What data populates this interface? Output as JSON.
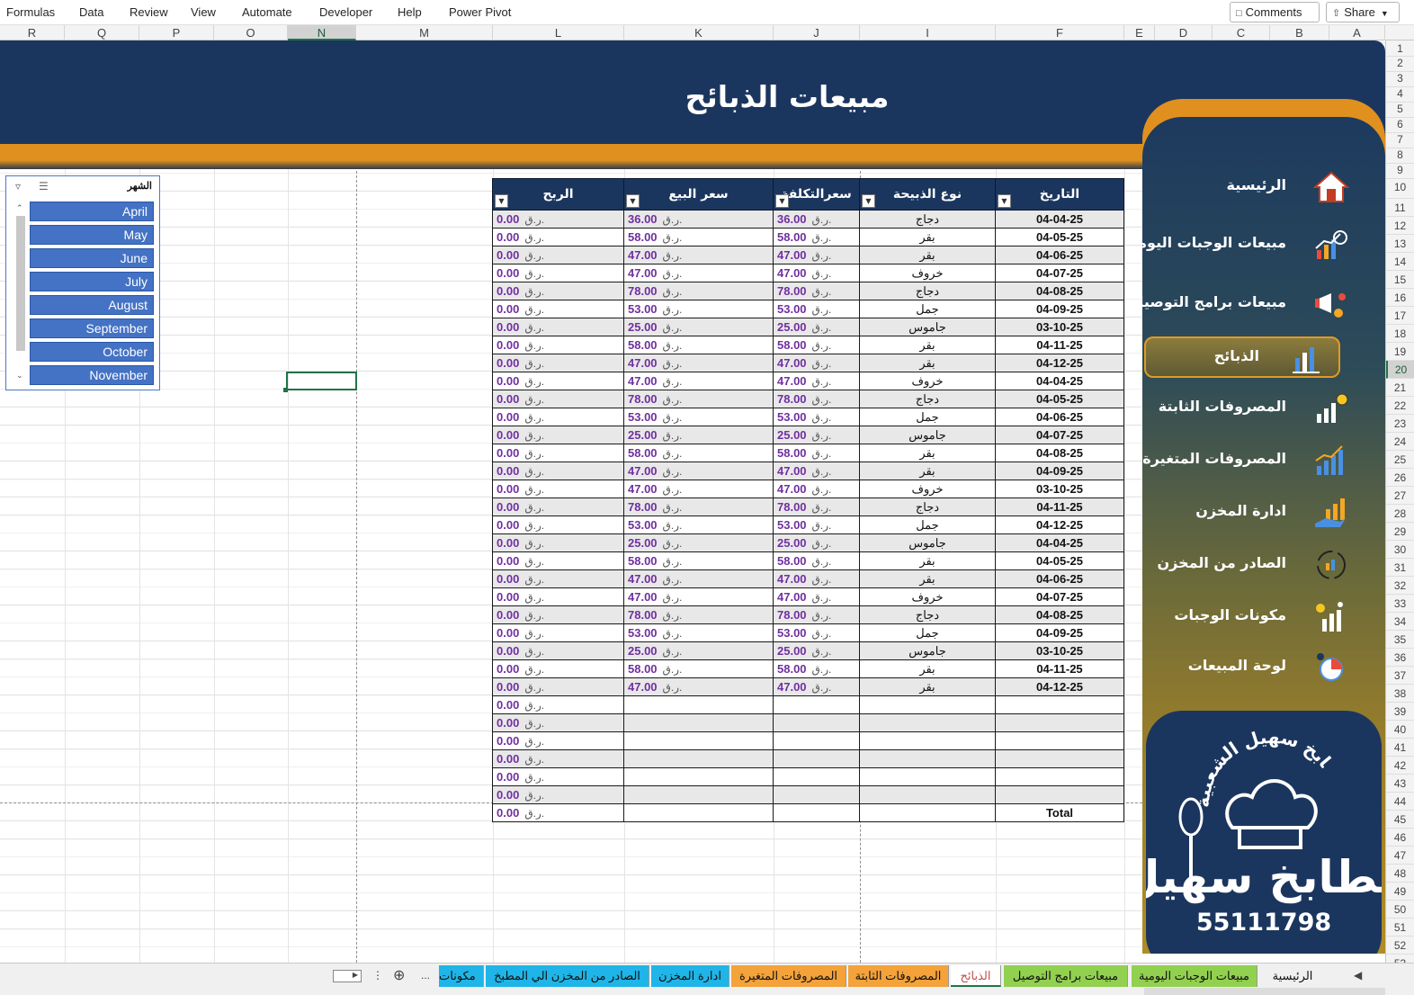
{
  "menu": {
    "items": [
      "Formulas",
      "Data",
      "Review",
      "View",
      "Automate",
      "Developer",
      "Help",
      "Power Pivot"
    ],
    "comments_label": "Comments",
    "share_label": "Share"
  },
  "columns": {
    "letters": [
      "R",
      "Q",
      "P",
      "O",
      "N",
      "M",
      "L",
      "K",
      "J",
      "I",
      "F",
      "E",
      "D",
      "C",
      "B",
      "A"
    ],
    "selected": "N"
  },
  "rows": {
    "numbers": [
      "1",
      "2",
      "3",
      "4",
      "5",
      "6",
      "7",
      "8",
      "9",
      "10",
      "11",
      "12",
      "13",
      "14",
      "15",
      "16",
      "17",
      "18",
      "19",
      "20",
      "21",
      "22",
      "23",
      "24",
      "25",
      "26",
      "27",
      "28",
      "29",
      "30",
      "31",
      "32",
      "33",
      "34",
      "35",
      "36",
      "37",
      "38",
      "39",
      "40",
      "41",
      "42",
      "43",
      "44",
      "45",
      "46",
      "47",
      "48",
      "49",
      "50",
      "51",
      "52",
      "53"
    ],
    "selected": "20"
  },
  "banner": {
    "title": "مبيعات الذبائح"
  },
  "sidebar": {
    "items": [
      {
        "label": "الرئيسية",
        "icon": "home-icon"
      },
      {
        "label": "مبيعات الوجبات اليومية",
        "icon": "growth-chart-icon"
      },
      {
        "label": "مبيعات برامج التوصيل",
        "icon": "megaphone-icon"
      },
      {
        "label": "الذبائح",
        "icon": "bar-chart-icon",
        "active": true
      },
      {
        "label": "المصروفات الثابتة",
        "icon": "coins-chart-icon"
      },
      {
        "label": "المصروفات المتغيرة",
        "icon": "trend-chart-icon"
      },
      {
        "label": "ادارة المخزن",
        "icon": "hand-chart-icon"
      },
      {
        "label": "الصادر من المخزن",
        "icon": "cycle-icon"
      },
      {
        "label": "مكونات الوجبات",
        "icon": "analytics-icon"
      },
      {
        "label": "لوحة المبيعات",
        "icon": "dashboard-icon"
      }
    ],
    "logo": {
      "arc_text": "مطابخ سهيل الشعبية",
      "brand_text": "مطابخ سهيل",
      "phone": "55111798"
    }
  },
  "slicer": {
    "title": "الشهر",
    "items": [
      "April",
      "May",
      "June",
      "July",
      "August",
      "September",
      "October",
      "November"
    ]
  },
  "table": {
    "headers": {
      "date": "التاريخ",
      "type": "نوع الذبيحة",
      "cost": "سعرالتكلفة",
      "price": "سعر البيع",
      "profit": "الربح"
    },
    "currency": "ر.ق.",
    "rows": [
      {
        "date": "04-04-25",
        "type": "دجاج",
        "cost": "36.00",
        "price": "36.00",
        "profit": "0.00"
      },
      {
        "date": "04-05-25",
        "type": "بقر",
        "cost": "58.00",
        "price": "58.00",
        "profit": "0.00"
      },
      {
        "date": "04-06-25",
        "type": "بقر",
        "cost": "47.00",
        "price": "47.00",
        "profit": "0.00"
      },
      {
        "date": "04-07-25",
        "type": "خروف",
        "cost": "47.00",
        "price": "47.00",
        "profit": "0.00"
      },
      {
        "date": "04-08-25",
        "type": "دجاج",
        "cost": "78.00",
        "price": "78.00",
        "profit": "0.00"
      },
      {
        "date": "04-09-25",
        "type": "جمل",
        "cost": "53.00",
        "price": "53.00",
        "profit": "0.00"
      },
      {
        "date": "03-10-25",
        "type": "جاموس",
        "cost": "25.00",
        "price": "25.00",
        "profit": "0.00"
      },
      {
        "date": "04-11-25",
        "type": "بقر",
        "cost": "58.00",
        "price": "58.00",
        "profit": "0.00"
      },
      {
        "date": "04-12-25",
        "type": "بقر",
        "cost": "47.00",
        "price": "47.00",
        "profit": "0.00"
      },
      {
        "date": "04-04-25",
        "type": "خروف",
        "cost": "47.00",
        "price": "47.00",
        "profit": "0.00"
      },
      {
        "date": "04-05-25",
        "type": "دجاج",
        "cost": "78.00",
        "price": "78.00",
        "profit": "0.00"
      },
      {
        "date": "04-06-25",
        "type": "جمل",
        "cost": "53.00",
        "price": "53.00",
        "profit": "0.00"
      },
      {
        "date": "04-07-25",
        "type": "جاموس",
        "cost": "25.00",
        "price": "25.00",
        "profit": "0.00"
      },
      {
        "date": "04-08-25",
        "type": "بقر",
        "cost": "58.00",
        "price": "58.00",
        "profit": "0.00"
      },
      {
        "date": "04-09-25",
        "type": "بقر",
        "cost": "47.00",
        "price": "47.00",
        "profit": "0.00"
      },
      {
        "date": "03-10-25",
        "type": "خروف",
        "cost": "47.00",
        "price": "47.00",
        "profit": "0.00"
      },
      {
        "date": "04-11-25",
        "type": "دجاج",
        "cost": "78.00",
        "price": "78.00",
        "profit": "0.00"
      },
      {
        "date": "04-12-25",
        "type": "جمل",
        "cost": "53.00",
        "price": "53.00",
        "profit": "0.00"
      },
      {
        "date": "04-04-25",
        "type": "جاموس",
        "cost": "25.00",
        "price": "25.00",
        "profit": "0.00"
      },
      {
        "date": "04-05-25",
        "type": "بقر",
        "cost": "58.00",
        "price": "58.00",
        "profit": "0.00"
      },
      {
        "date": "04-06-25",
        "type": "بقر",
        "cost": "47.00",
        "price": "47.00",
        "profit": "0.00"
      },
      {
        "date": "04-07-25",
        "type": "خروف",
        "cost": "47.00",
        "price": "47.00",
        "profit": "0.00"
      },
      {
        "date": "04-08-25",
        "type": "دجاج",
        "cost": "78.00",
        "price": "78.00",
        "profit": "0.00"
      },
      {
        "date": "04-09-25",
        "type": "جمل",
        "cost": "53.00",
        "price": "53.00",
        "profit": "0.00"
      },
      {
        "date": "03-10-25",
        "type": "جاموس",
        "cost": "25.00",
        "price": "25.00",
        "profit": "0.00"
      },
      {
        "date": "04-11-25",
        "type": "بقر",
        "cost": "58.00",
        "price": "58.00",
        "profit": "0.00"
      },
      {
        "date": "04-12-25",
        "type": "بقر",
        "cost": "47.00",
        "price": "47.00",
        "profit": "0.00"
      },
      {
        "date": "",
        "type": "",
        "cost": "",
        "price": "",
        "profit": "0.00"
      },
      {
        "date": "",
        "type": "",
        "cost": "",
        "price": "",
        "profit": "0.00"
      },
      {
        "date": "",
        "type": "",
        "cost": "",
        "price": "",
        "profit": "0.00"
      },
      {
        "date": "",
        "type": "",
        "cost": "",
        "price": "",
        "profit": "0.00"
      },
      {
        "date": "",
        "type": "",
        "cost": "",
        "price": "",
        "profit": "0.00"
      },
      {
        "date": "",
        "type": "",
        "cost": "",
        "price": "",
        "profit": "0.00"
      }
    ],
    "total": {
      "label": "Total",
      "profit": "0.00"
    }
  },
  "sheet_tabs": [
    {
      "label": "الرئيسية",
      "color": "#f0f0f0"
    },
    {
      "label": "مبيعات الوجبات اليومية",
      "color": "#92d050"
    },
    {
      "label": "مبيعات برامج التوصيل",
      "color": "#92d050"
    },
    {
      "label": "الذبائح",
      "color": "#ffffff",
      "active": true
    },
    {
      "label": "المصروفات الثابتة",
      "color": "#f4a23a"
    },
    {
      "label": "المصروفات المتغيرة",
      "color": "#f4a23a"
    },
    {
      "label": "ادارة المخزن",
      "color": "#1fb5e8"
    },
    {
      "label": "الصادر من المخزن الي المطبخ",
      "color": "#1fb5e8"
    },
    {
      "label": "مكونات",
      "color": "#1fb5e8"
    }
  ],
  "tab_controls": {
    "more_label": "..."
  }
}
